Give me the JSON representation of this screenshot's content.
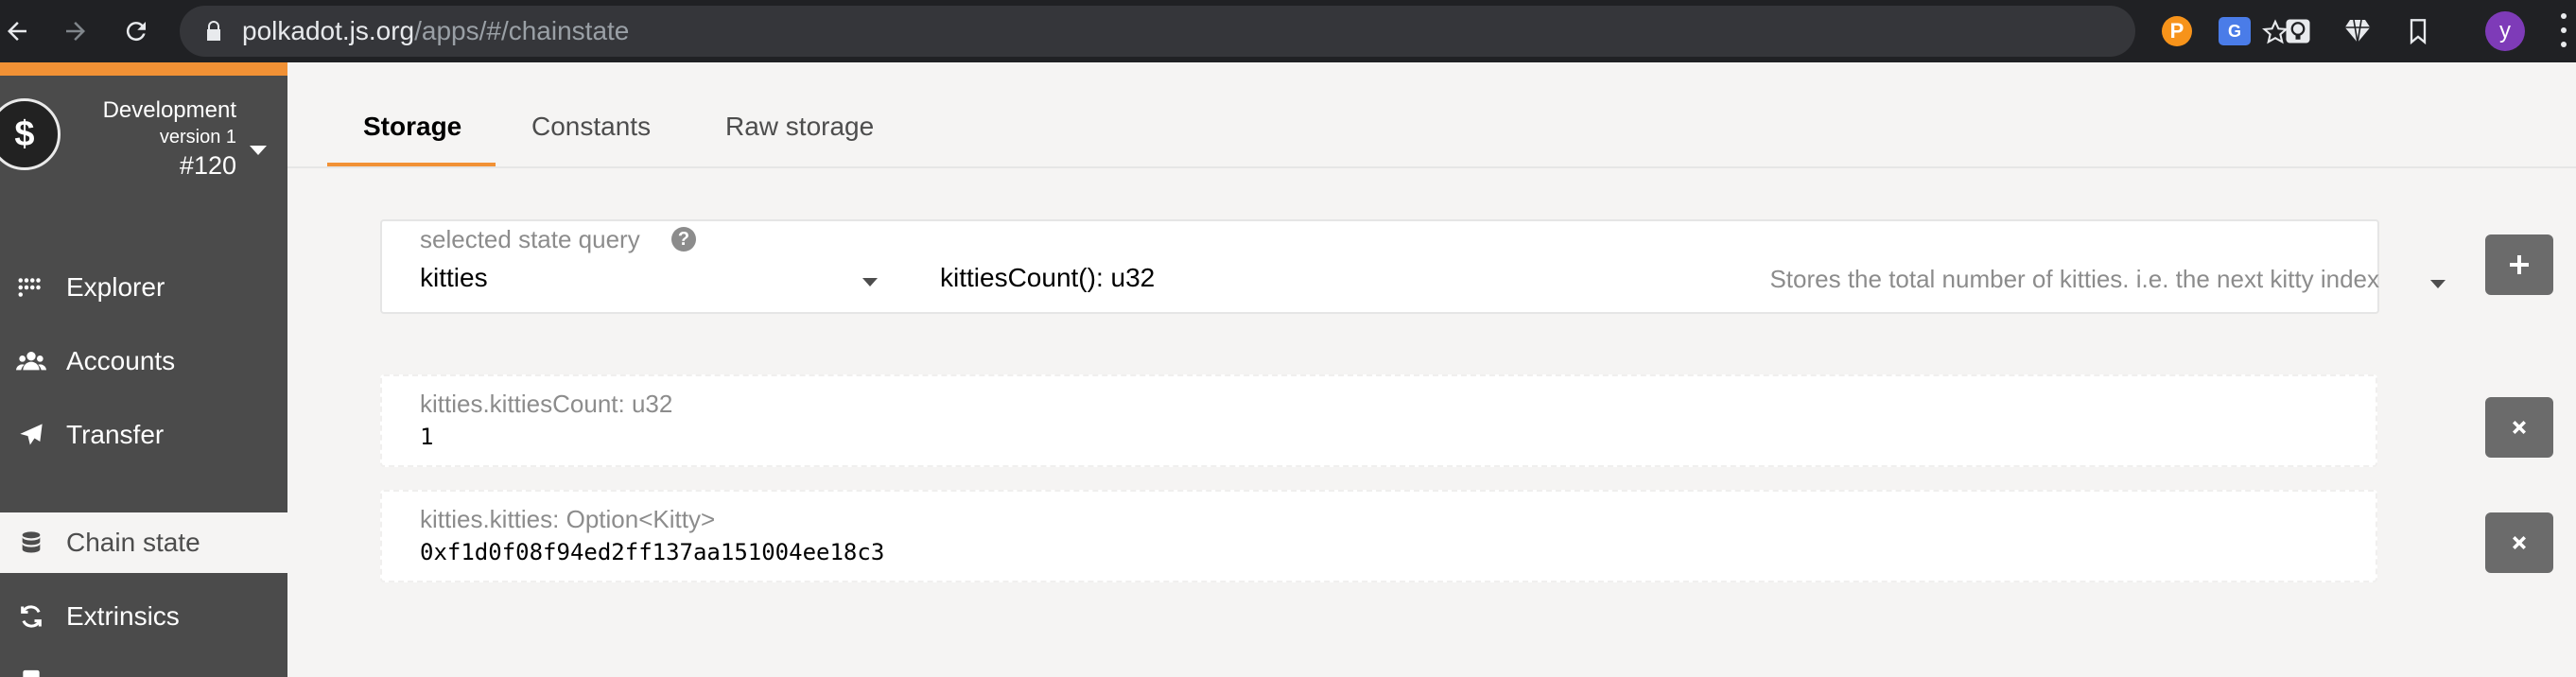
{
  "browser": {
    "url_host": "polkadot.js.org",
    "url_path": "/apps/#/chainstate",
    "profile_initial": "y",
    "extension_letters": [
      "P",
      "G"
    ]
  },
  "sidebar": {
    "chain": {
      "name": "Development",
      "version": "version 1",
      "block": "#120",
      "logo_glyph": "$"
    },
    "items": [
      {
        "label": "Explorer",
        "icon": "grid-dots-icon"
      },
      {
        "label": "Accounts",
        "icon": "users-icon"
      },
      {
        "label": "Transfer",
        "icon": "paper-plane-icon"
      },
      {
        "label": "Chain state",
        "icon": "database-icon",
        "active": true
      },
      {
        "label": "Extrinsics",
        "icon": "sync-icon"
      }
    ]
  },
  "tabs": [
    {
      "label": "Storage",
      "active": true
    },
    {
      "label": "Constants"
    },
    {
      "label": "Raw storage"
    }
  ],
  "query": {
    "label": "selected state query",
    "help_glyph": "?",
    "module": "kitties",
    "method": "kittiesCount(): u32",
    "doc": "Stores the total number of kitties. i.e. the next kitty index"
  },
  "results": [
    {
      "label": "kitties.kittiesCount: u32",
      "value": "1"
    },
    {
      "label": "kitties.kitties: Option<Kitty>",
      "value": "0xf1d0f08f94ed2ff137aa151004ee18c3"
    }
  ],
  "colors": {
    "accent": "#f19135",
    "sidebar_bg": "#4b4b4b",
    "button_bg": "#6b6b6b"
  }
}
